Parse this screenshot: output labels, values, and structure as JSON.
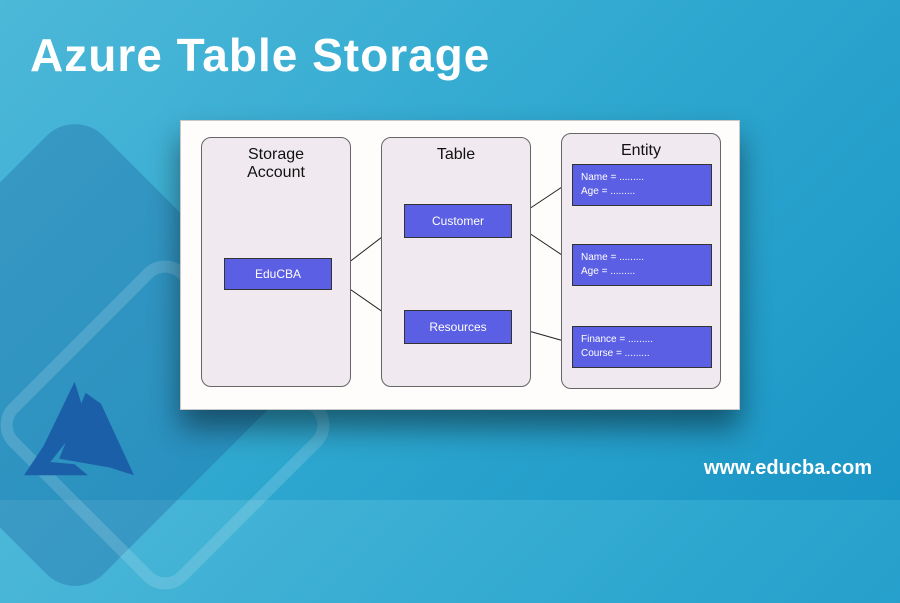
{
  "title": "Azure Table Storage",
  "url": "www.educba.com",
  "diagram": {
    "columns": {
      "account": {
        "header": "Storage\nAccount",
        "box": "EduCBA"
      },
      "table": {
        "header": "Table",
        "boxes": [
          "Customer",
          "Resources"
        ]
      },
      "entity": {
        "header": "Entity",
        "boxes": [
          {
            "line1": "Name = .........",
            "line2": "Age = ........."
          },
          {
            "line1": "Name = .........",
            "line2": "Age = ........."
          },
          {
            "line1": "Finance = .........",
            "line2": "Course = ........."
          }
        ]
      }
    }
  },
  "chart_data": {
    "type": "diagram",
    "title": "Azure Table Storage structure",
    "nodes": [
      {
        "id": "account",
        "label": "EduCBA",
        "group": "Storage Account"
      },
      {
        "id": "t1",
        "label": "Customer",
        "group": "Table"
      },
      {
        "id": "t2",
        "label": "Resources",
        "group": "Table"
      },
      {
        "id": "e1",
        "label": "Name / Age",
        "group": "Entity"
      },
      {
        "id": "e2",
        "label": "Name / Age",
        "group": "Entity"
      },
      {
        "id": "e3",
        "label": "Finance / Course",
        "group": "Entity"
      }
    ],
    "edges": [
      [
        "account",
        "t1"
      ],
      [
        "account",
        "t2"
      ],
      [
        "t1",
        "e1"
      ],
      [
        "t1",
        "e2"
      ],
      [
        "t2",
        "e3"
      ]
    ]
  }
}
